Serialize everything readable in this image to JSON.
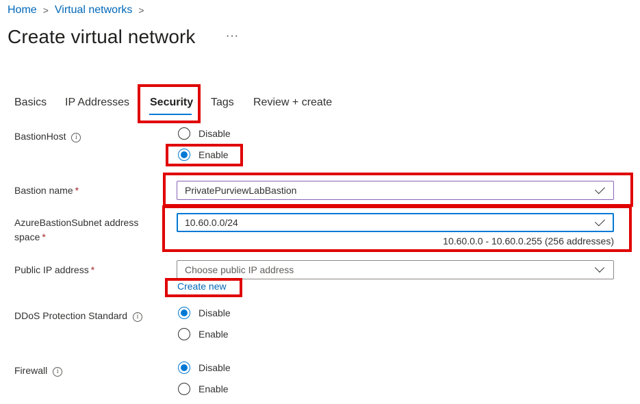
{
  "breadcrumb": {
    "home": "Home",
    "separator": ">",
    "virtual_networks": "Virtual networks",
    "trailing_separator": ">"
  },
  "page": {
    "title": "Create virtual network",
    "more": "···"
  },
  "tabs": [
    {
      "label": "Basics",
      "active": false
    },
    {
      "label": "IP Addresses",
      "active": false
    },
    {
      "label": "Security",
      "active": true
    },
    {
      "label": "Tags",
      "active": false
    },
    {
      "label": "Review + create",
      "active": false
    }
  ],
  "fields": {
    "bastion_host": {
      "label": "BastionHost",
      "info": "i",
      "options": [
        "Disable",
        "Enable"
      ],
      "selected": "Enable"
    },
    "bastion_name": {
      "label": "Bastion name",
      "required_mark": "*",
      "value": "PrivatePurviewLabBastion"
    },
    "subnet_address_space": {
      "label_line1": "AzureBastionSubnet address",
      "label_line2": "space",
      "required_mark": "*",
      "value": "10.60.0.0/24",
      "hint": "10.60.0.0 - 10.60.0.255 (256 addresses)"
    },
    "public_ip": {
      "label": "Public IP address",
      "required_mark": "*",
      "placeholder": "Choose public IP address",
      "create_new": "Create new"
    },
    "ddos": {
      "label": "DDoS Protection Standard",
      "info": "i",
      "options": [
        "Disable",
        "Enable"
      ],
      "selected": "Disable"
    },
    "firewall": {
      "label": "Firewall",
      "info": "i",
      "options": [
        "Disable",
        "Enable"
      ],
      "selected": "Disable"
    }
  },
  "colors": {
    "accent": "#0078d4",
    "link": "#0067b8",
    "highlight": "#e00000",
    "required": "#a4262c"
  }
}
